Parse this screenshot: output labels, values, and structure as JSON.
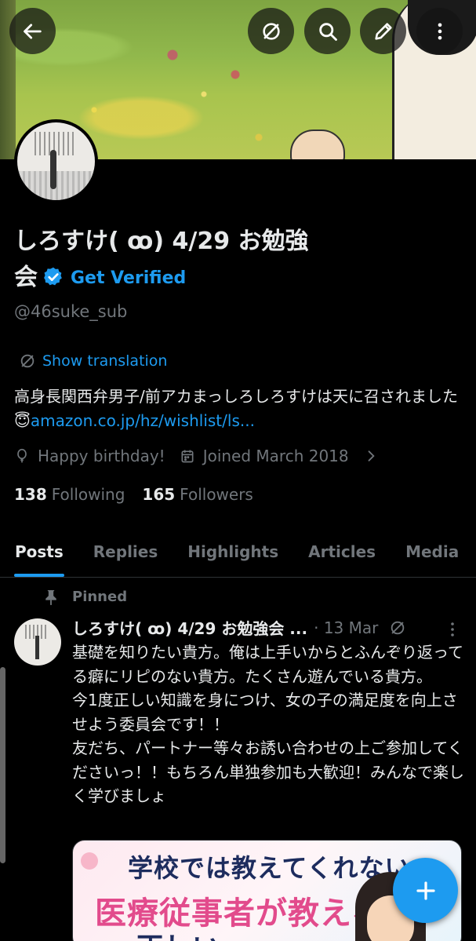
{
  "profile": {
    "name_line1": "しろすけ( ꝏ) 4/29 お勉強",
    "name_line2": "会",
    "get_verified_label": "Get Verified",
    "handle": "@46suke_sub",
    "show_translation_label": "Show translation",
    "bio_text": "高身長関西弁男子/前アカまっしろしろすけは天に召されました😇",
    "bio_link": "amazon.co.jp/hz/wishlist/ls...",
    "birthday_label": "Happy birthday!",
    "joined_label": "Joined March 2018",
    "following_count": "138",
    "following_label": "Following",
    "followers_count": "165",
    "followers_label": "Followers"
  },
  "tabs": [
    "Posts",
    "Replies",
    "Highlights",
    "Articles",
    "Media"
  ],
  "pinned_post": {
    "pinned_label": "Pinned",
    "author": "しろすけ( ꝏ) 4/29 お勉強会 ...",
    "date": "· 13 Mar",
    "text": "基礎を知りたい貴方。俺は上手いからとふんぞり返ってる癖にリピのない貴方。たくさん遊んでいる貴方。\n今1度正しい知識を身につけ、女の子の満足度を向上させよう委員会です！！\n友だち、パートナー等々お誘い合わせの上ご参加してくださいっ！！もちろん単独参加も大歓迎！みんなで楽しく学びましょ",
    "media_line1": "学校では教えてくれない",
    "media_line2": "医療従事者が教える！",
    "media_line3": "正しい"
  },
  "colors": {
    "accent": "#1d9bf0",
    "background": "#000000",
    "secondary_text": "#71767b"
  }
}
